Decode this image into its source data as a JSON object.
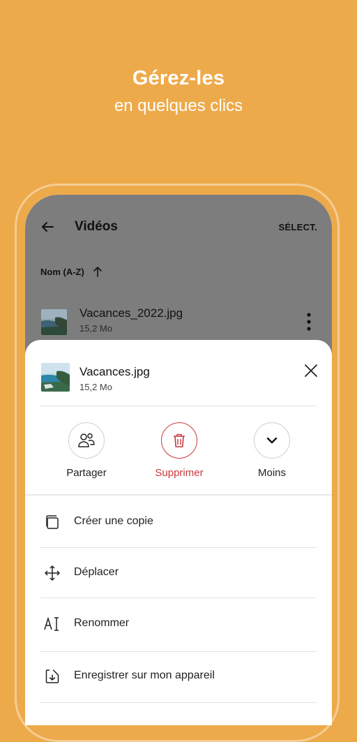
{
  "hero": {
    "title": "Gérez-les",
    "subtitle": "en quelques clics"
  },
  "header": {
    "title": "Vidéos",
    "select_label": "SÉLECT."
  },
  "sort": {
    "label": "Nom (A-Z)"
  },
  "file_list": [
    {
      "name": "Vacances_2022.jpg",
      "size": "15,2 Mo"
    }
  ],
  "sheet": {
    "file": {
      "name": "Vacances.jpg",
      "size": "15,2 Mo"
    },
    "actions": [
      {
        "label": "Partager",
        "icon": "people-icon"
      },
      {
        "label": "Supprimer",
        "icon": "trash-icon",
        "color": "#C8373D"
      },
      {
        "label": "Moins",
        "icon": "chevron-down-icon"
      }
    ],
    "menu": [
      {
        "label": "Créer une copie",
        "icon": "copy-icon"
      },
      {
        "label": "Déplacer",
        "icon": "move-icon"
      },
      {
        "label": "Renommer",
        "icon": "rename-icon"
      },
      {
        "label": "Enregistrer sur mon appareil",
        "icon": "download-icon"
      }
    ]
  },
  "colors": {
    "background": "#EDAA4B",
    "danger": "#C8373D",
    "overlay": "#7D7D7D"
  }
}
